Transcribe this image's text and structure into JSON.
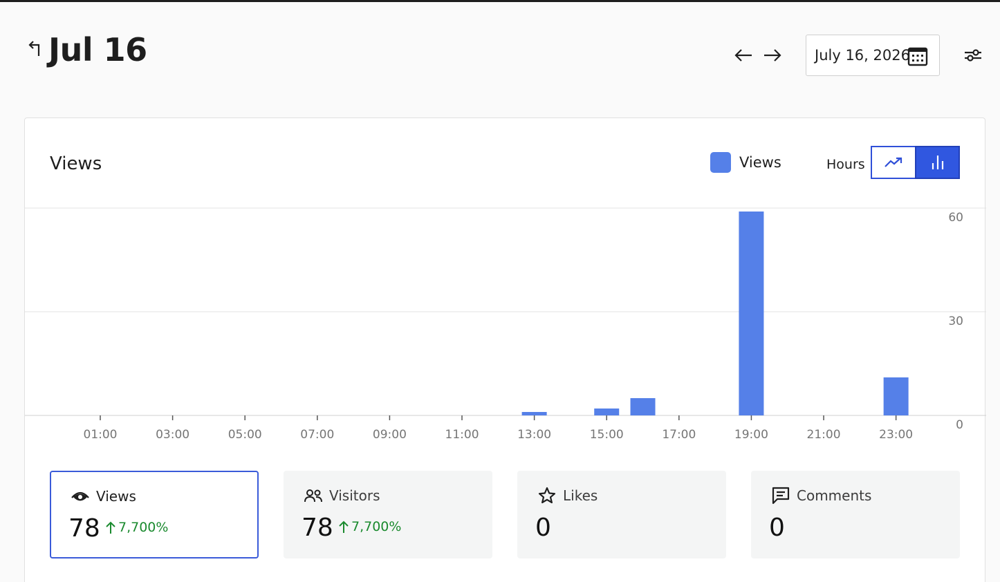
{
  "header": {
    "title": "Jul 16",
    "date_value": "July 16, 2026"
  },
  "card": {
    "title": "Views",
    "legend_label": "Views",
    "interval_label": "Hours"
  },
  "colors": {
    "accent": "#3057e0",
    "bar": "#5580e8",
    "positive": "#1a8a2e"
  },
  "chart_data": {
    "type": "bar",
    "categories": [
      "00:00",
      "01:00",
      "02:00",
      "03:00",
      "04:00",
      "05:00",
      "06:00",
      "07:00",
      "08:00",
      "09:00",
      "10:00",
      "11:00",
      "12:00",
      "13:00",
      "14:00",
      "15:00",
      "16:00",
      "17:00",
      "18:00",
      "19:00",
      "20:00",
      "21:00",
      "22:00",
      "23:00"
    ],
    "tick_labels": [
      "01:00",
      "03:00",
      "05:00",
      "07:00",
      "09:00",
      "11:00",
      "13:00",
      "15:00",
      "17:00",
      "19:00",
      "21:00",
      "23:00"
    ],
    "series": [
      {
        "name": "Views",
        "values": [
          0,
          0,
          0,
          0,
          0,
          0,
          0,
          0,
          0,
          0,
          0,
          0,
          0,
          1,
          0,
          2,
          5,
          0,
          0,
          59,
          0,
          0,
          0,
          11
        ]
      }
    ],
    "y_ticks": [
      0,
      30,
      60
    ],
    "ylim": [
      0,
      60
    ],
    "grid": true,
    "y_axis_side": "right",
    "legend_position": "top-right"
  },
  "stats": [
    {
      "label": "Views",
      "value": "78",
      "change": "7,700%",
      "icon": "eye-icon",
      "active": true
    },
    {
      "label": "Visitors",
      "value": "78",
      "change": "7,700%",
      "icon": "people-icon",
      "active": false
    },
    {
      "label": "Likes",
      "value": "0",
      "change": "",
      "icon": "star-icon",
      "active": false
    },
    {
      "label": "Comments",
      "value": "0",
      "change": "",
      "icon": "comment-icon",
      "active": false
    }
  ]
}
